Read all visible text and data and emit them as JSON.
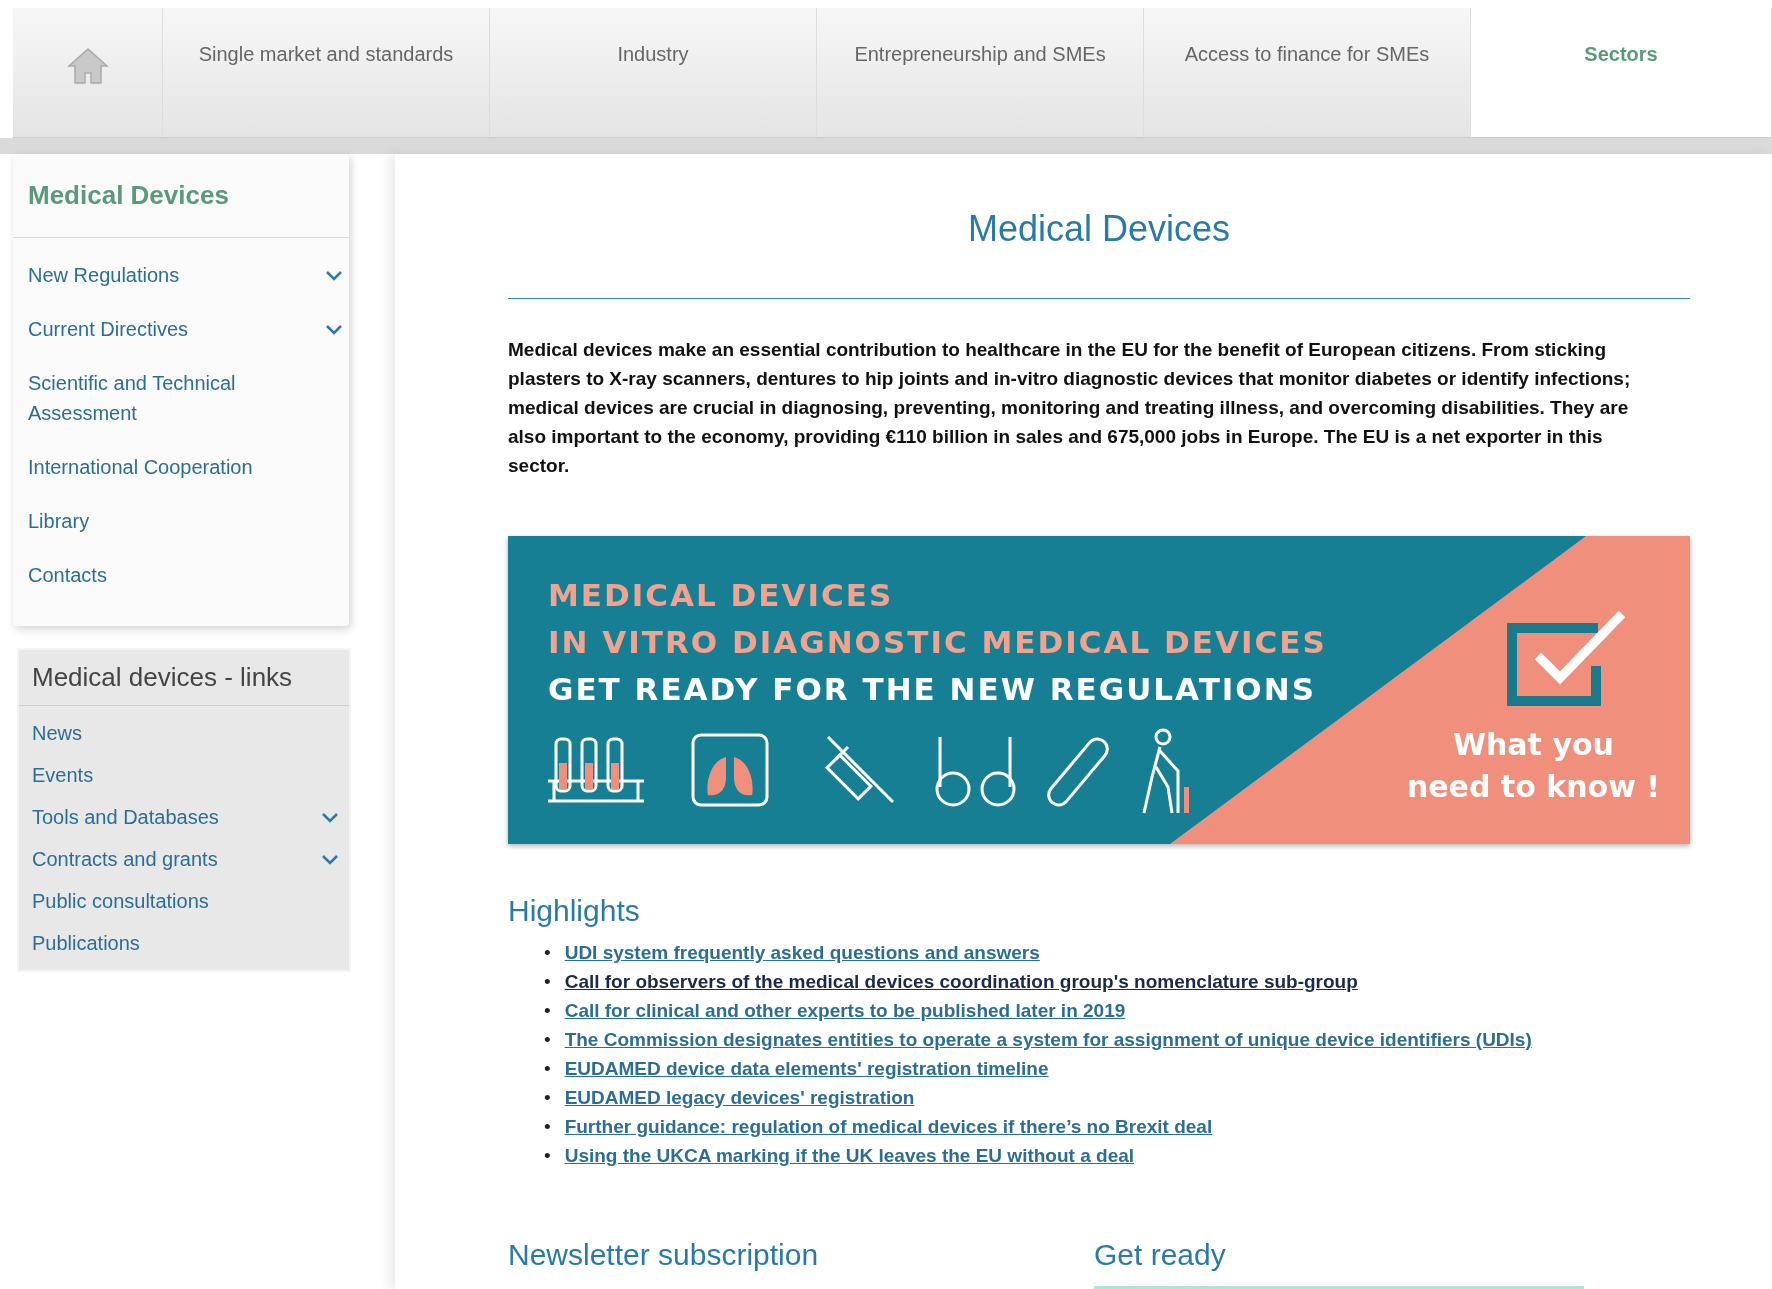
{
  "nav": {
    "tabs": [
      {
        "label": "Single market and standards",
        "selected": false
      },
      {
        "label": "Industry",
        "selected": false
      },
      {
        "label": "Entrepreneurship and SMEs",
        "selected": false
      },
      {
        "label": "Access to finance for SMEs",
        "selected": false
      },
      {
        "label": "Sectors",
        "selected": true
      }
    ]
  },
  "sidebar": {
    "title": "Medical Devices",
    "items": [
      {
        "label": "New Regulations",
        "expandable": true
      },
      {
        "label": "Current Directives",
        "expandable": true
      },
      {
        "label": "Scientific and Technical Assessment",
        "expandable": false
      },
      {
        "label": "International Cooperation",
        "expandable": false
      },
      {
        "label": "Library",
        "expandable": false
      },
      {
        "label": "Contacts",
        "expandable": false
      }
    ]
  },
  "links": {
    "title": "Medical devices - links",
    "items": [
      {
        "label": "News",
        "expandable": false
      },
      {
        "label": "Events",
        "expandable": false
      },
      {
        "label": "Tools and Databases",
        "expandable": true
      },
      {
        "label": "Contracts and grants",
        "expandable": true
      },
      {
        "label": "Public consultations",
        "expandable": false
      },
      {
        "label": "Publications",
        "expandable": false
      }
    ]
  },
  "main": {
    "title": "Medical Devices",
    "intro": "Medical devices make an essential contribution to healthcare in the EU for the benefit of European citizens. From sticking plasters to X-ray scanners, dentures to hip joints and in-vitro diagnostic devices that monitor diabetes or identify infections; medical devices are crucial in diagnosing, preventing, monitoring and treating illness, and overcoming disabilities. They are also important to the economy, providing €110 billion in sales and 675,000 jobs in Europe. The EU is a net exporter in this sector.",
    "banner": {
      "lines": [
        "MEDICAL DEVICES",
        "IN VITRO DIAGNOSTIC MEDICAL DEVICES",
        "GET READY FOR THE NEW REGULATIONS"
      ],
      "callout": [
        "What you",
        "need to know !"
      ]
    },
    "highlights": {
      "title": "Highlights",
      "items": [
        {
          "bullet": "•",
          "label": "UDI system frequently asked questions and answers",
          "visited": false
        },
        {
          "bullet": "•",
          "label": "Call for observers of the medical devices coordination group's nomenclature sub-group",
          "visited": true
        },
        {
          "bullet": "•",
          "label": "Call for clinical and other experts to be published later in 2019",
          "visited": false
        },
        {
          "bullet": "•",
          "label": "The Commission designates entities to operate a system for assignment of unique device identifiers (UDIs)",
          "visited": false
        },
        {
          "bullet": "•",
          "label": "EUDAMED device data elements' registration timeline",
          "visited": false
        },
        {
          "bullet": "•",
          "label": "EUDAMED legacy devices' registration",
          "visited": false
        },
        {
          "bullet": "•",
          "label": "Further guidance: regulation of medical devices if there’s no Brexit deal",
          "visited": false
        },
        {
          "bullet": "•",
          "label": "Using the UKCA marking if the UK leaves the EU without a deal",
          "visited": false
        }
      ]
    },
    "sections": [
      {
        "title": "Newsletter subscription"
      },
      {
        "title": "Get ready"
      }
    ]
  }
}
